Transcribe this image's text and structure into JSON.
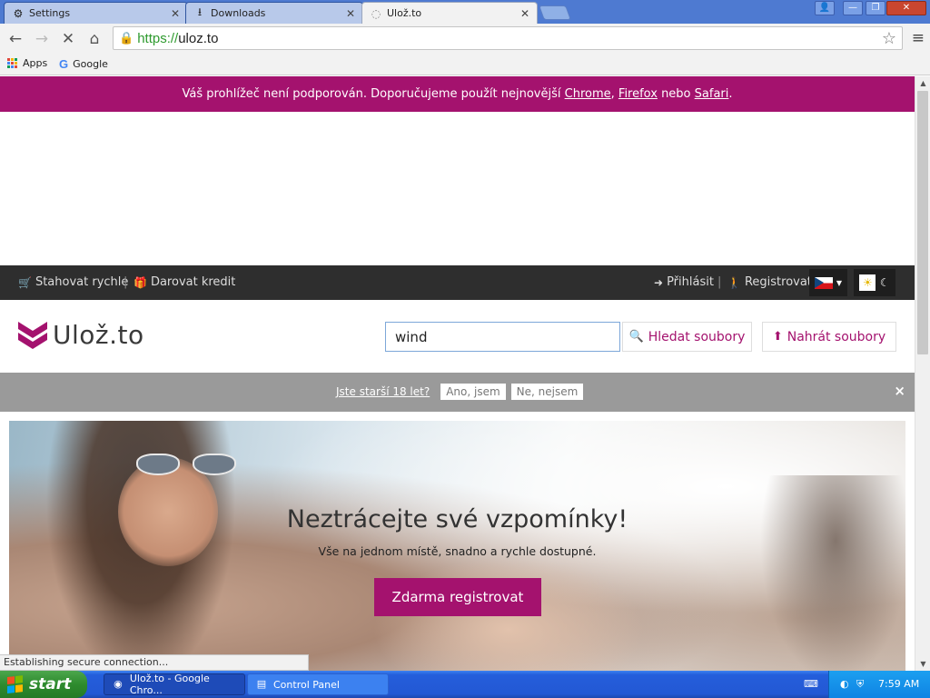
{
  "browser": {
    "tabs": [
      {
        "label": "Settings",
        "icon": "gear-icon"
      },
      {
        "label": "Downloads",
        "icon": "download-icon"
      },
      {
        "label": "Ulož.to",
        "icon": "loading-spinner-icon",
        "active": true
      }
    ],
    "address": {
      "scheme": "https://",
      "host": "uloz.to"
    },
    "bookmarks": [
      {
        "label": "Apps",
        "icon": "apps-grid-icon"
      },
      {
        "label": "Google",
        "icon": "google-icon"
      }
    ],
    "status_text": "Establishing secure connection..."
  },
  "page": {
    "warning": {
      "text_before": "Váš prohlížeč není podporován. Doporučujeme použít nejnovější ",
      "link_chrome": "Chrome",
      "comma": ", ",
      "link_firefox": "Firefox",
      "text_or": " nebo ",
      "link_safari": "Safari",
      "period": "."
    },
    "topbar": {
      "download_fast": "Stahovat rychle",
      "donate_credit": "Darovat kredit",
      "login": "Přihlásit",
      "register": "Registrovat",
      "separator": "|"
    },
    "logo_text": "Ulož.to",
    "search": {
      "value": "wind",
      "button": "Hledat soubory"
    },
    "upload_button": "Nahrát soubory",
    "age_check": {
      "question": "Jste starší 18 let?",
      "yes": "Ano, jsem",
      "no": "Ne, nejsem",
      "close": "×"
    },
    "hero": {
      "title": "Neztrácejte své vzpomínky!",
      "subtitle": "Vše na jednom místě, snadno a rychle dostupné.",
      "cta": "Zdarma registrovat"
    }
  },
  "taskbar": {
    "start": "start",
    "tasks": [
      {
        "label": "Ulož.to - Google Chro...",
        "icon": "chrome-icon"
      },
      {
        "label": "Control Panel",
        "icon": "control-panel-icon"
      }
    ],
    "clock": "7:59 AM"
  },
  "colors": {
    "brand": "#a4126e",
    "topbar": "#2e2e2e",
    "age_bar": "#9a9a9a",
    "xp_blue": "#245edb",
    "xp_green": "#2e8b2e"
  }
}
